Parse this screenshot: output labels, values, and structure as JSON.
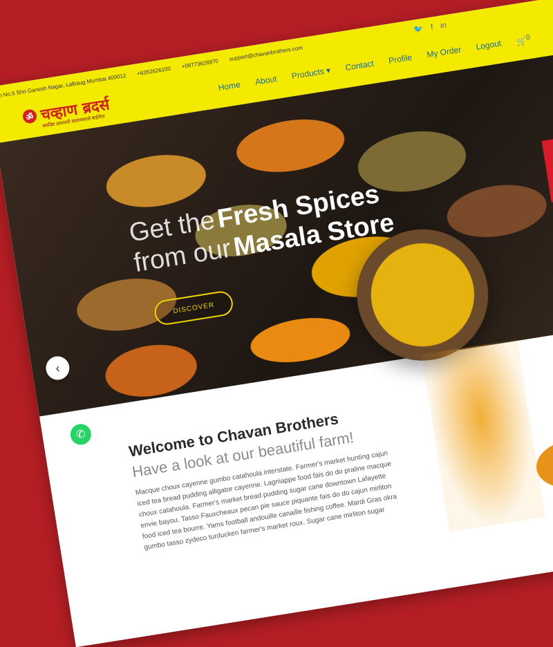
{
  "topbar": {
    "address": "op No.5 Shri Ganesh Nagar, Lalbaug Mumbai 400012",
    "phone1": "+6262626100",
    "phone2": "+09773628970",
    "email": "support@chavanbrothers.com",
    "social_icons": [
      "twitter-icon",
      "facebook-icon",
      "linkedin-icon"
    ]
  },
  "logo": {
    "text": "चव्हाण ब्रदर्स",
    "tagline": "स्वादिष्ट उत्पादनों वालामसाले बाहेरील"
  },
  "nav": {
    "items": [
      "Home",
      "About",
      "Products",
      "Contact",
      "Profile",
      "My Order",
      "Logout"
    ],
    "cart_count": "0"
  },
  "hero": {
    "line1_light": "Get the",
    "line1_bold": "Fresh Spices",
    "line2_light": "from our",
    "line2_bold": "Masala Store",
    "button": "DISCOVER"
  },
  "widgets": {
    "send_message": "Send message"
  },
  "welcome": {
    "title": "Welcome to Chavan Brothers",
    "subtitle": "Have a look at our beautiful farm!",
    "body": "Macque choux cayenne gumbo catahoula interstate. Farmer's market hunting cajun iced tea bread pudding alligator cayenne. Lagniappe food fais do do praline macque choux catahoula. Farmer's market bread pudding sugar cane downtown Lafayette envie bayou. Tasso Fauxcheaux pecan pie sauce piquante fais do do cajun mirliton food iced tea bourre. Yams football andouille canaille fishing coffee. Mardi Gras okra gumbo tasso zydeco turducken farmer's market roux. Sugar cane mirliton sugar"
  }
}
